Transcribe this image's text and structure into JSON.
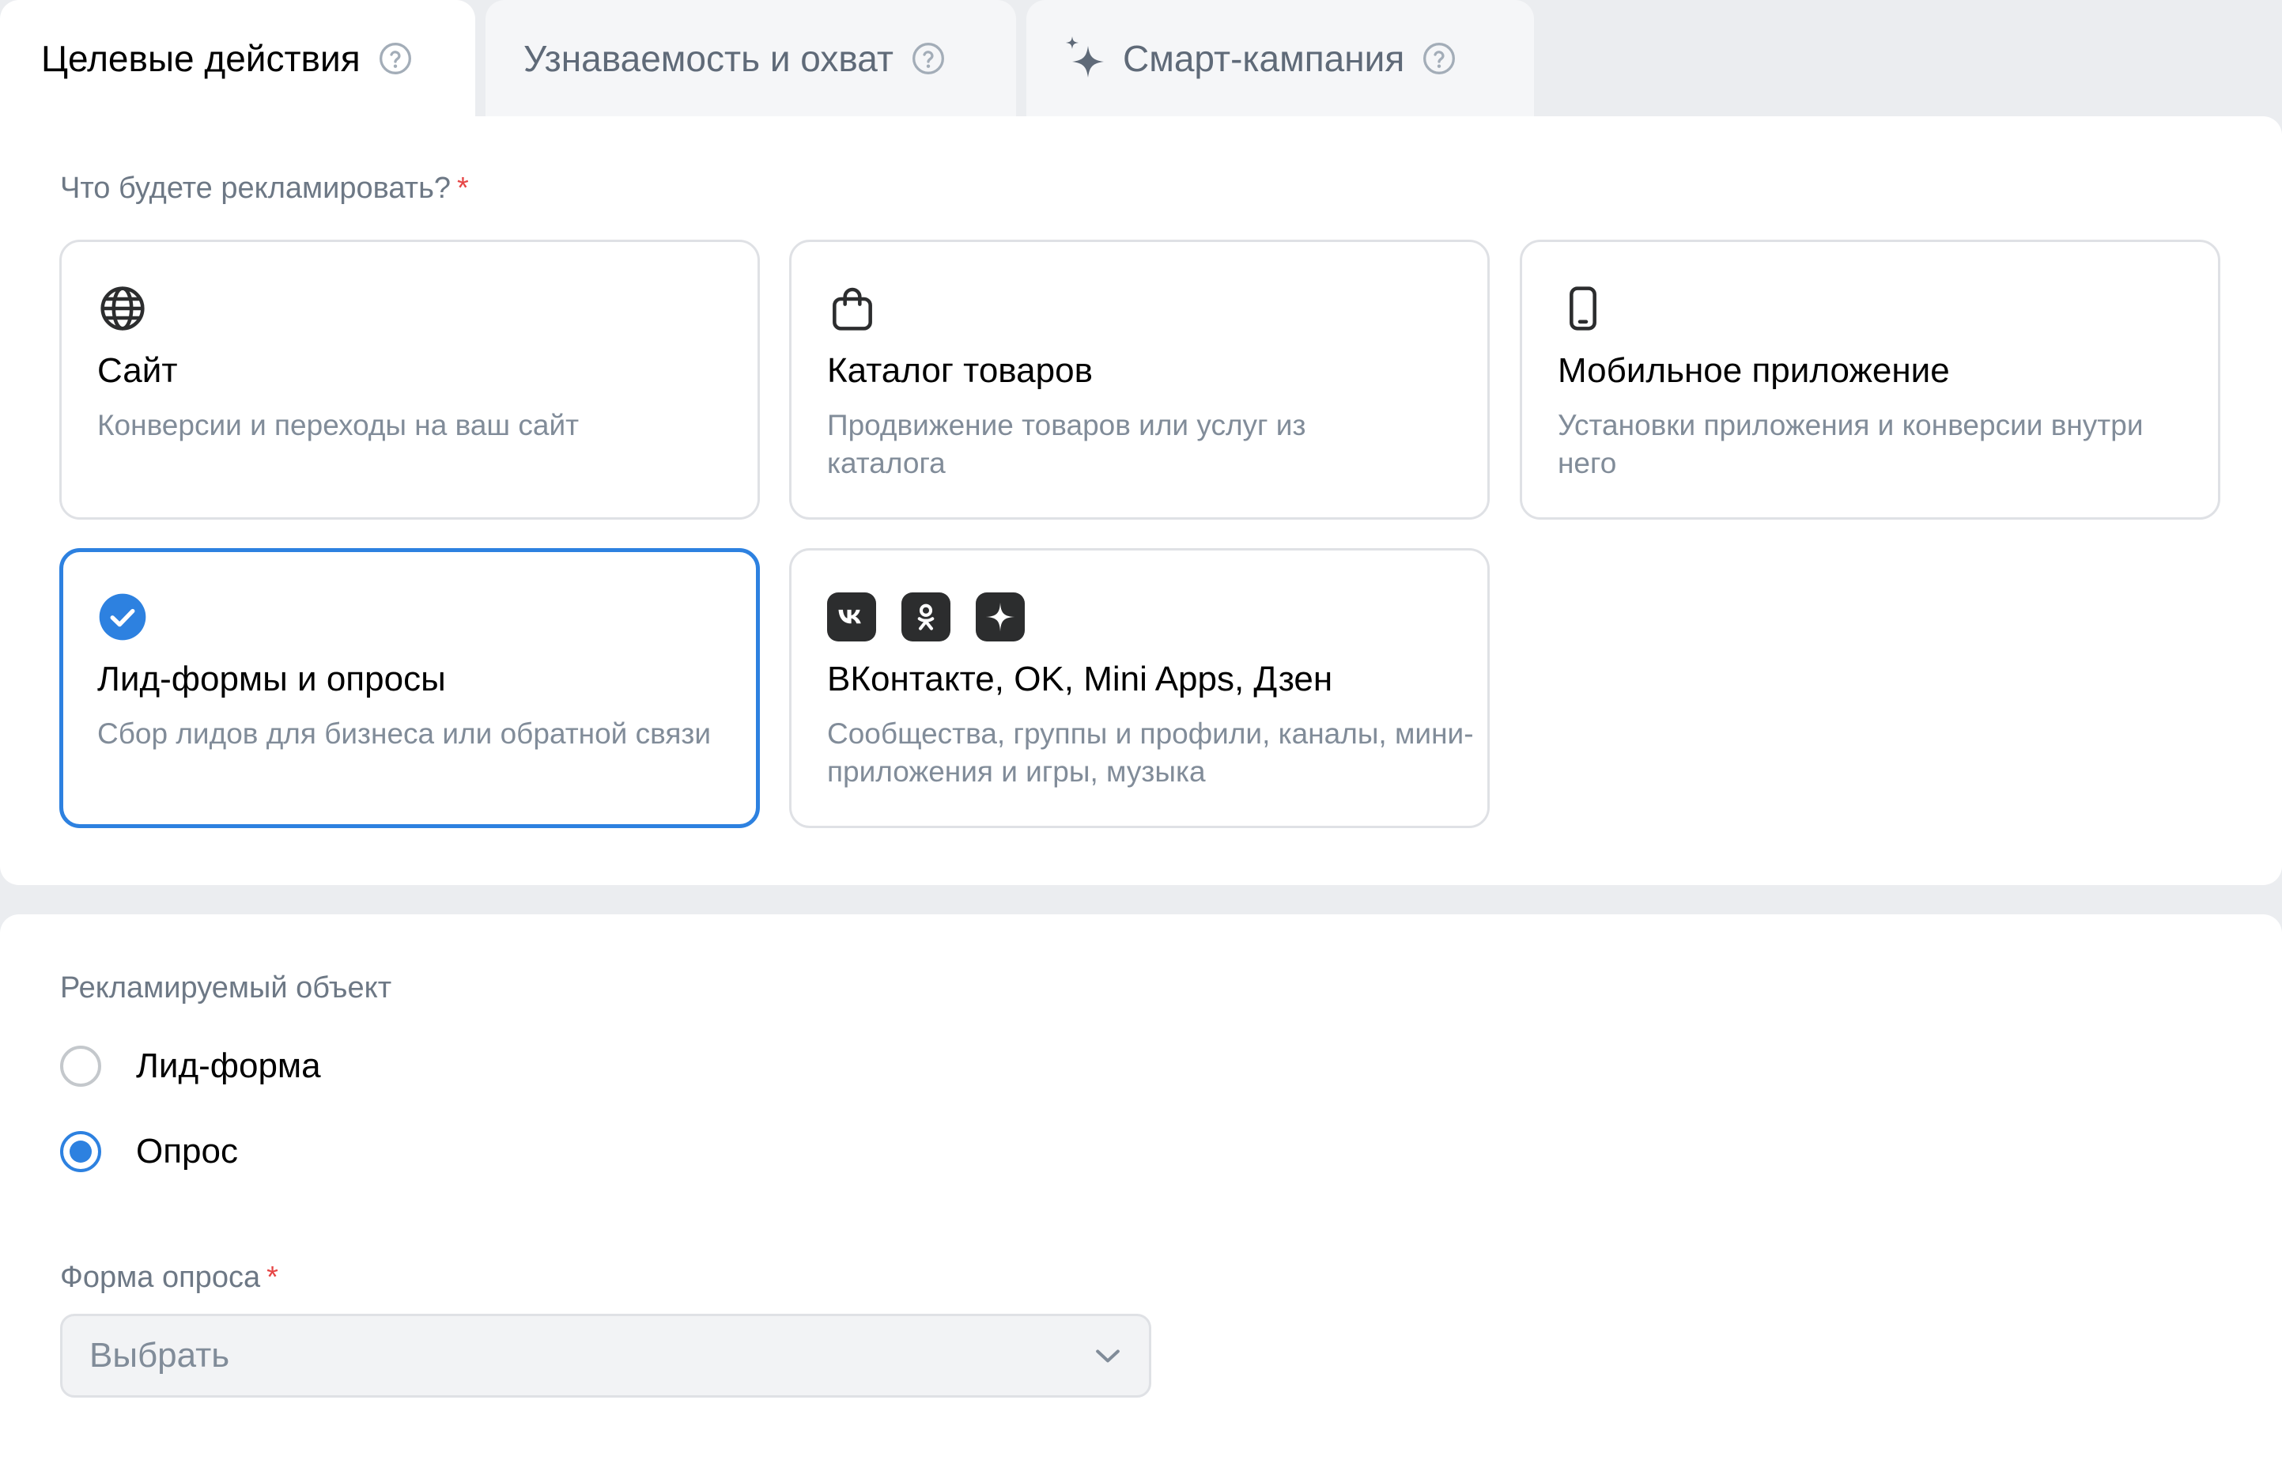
{
  "tabs": [
    {
      "label": "Целевые действия",
      "active": true
    },
    {
      "label": "Узнаваемость и охват",
      "active": false
    },
    {
      "label": "Смарт-кампания",
      "active": false
    }
  ],
  "promo_question": "Что будете рекламировать?",
  "required_mark": "*",
  "cards": [
    {
      "title": "Сайт",
      "desc": "Конверсии и переходы на ваш сайт",
      "icon": "globe-icon",
      "selected": false
    },
    {
      "title": "Каталог товаров",
      "desc": "Продвижение товаров или услуг из каталога",
      "icon": "shopping-bag-icon",
      "selected": false
    },
    {
      "title": "Мобильное приложение",
      "desc": "Установки приложения и конверсии внутри него",
      "icon": "smartphone-icon",
      "selected": false
    },
    {
      "title": "Лид-формы и опросы",
      "desc": "Сбор лидов для бизнеса или обратной связи",
      "icon": "checkmark-circle-icon",
      "selected": true
    },
    {
      "title": "ВКонтакте, OK, Mini Apps, Дзен",
      "desc": "Сообщества, группы и профили, каналы, мини-приложения и игры, музыка",
      "icons": [
        "vk-icon",
        "ok-icon",
        "dzen-icon"
      ],
      "selected": false
    }
  ],
  "object_label": "Рекламируемый объект",
  "radios": [
    {
      "label": "Лид-форма",
      "checked": false
    },
    {
      "label": "Опрос",
      "checked": true
    }
  ],
  "form_label": "Форма опроса",
  "select": {
    "value": "Выбрать"
  },
  "colors": {
    "accent": "#2d81e0",
    "required": "#e64646",
    "muted": "#818c99",
    "background": "#ebedf0"
  }
}
